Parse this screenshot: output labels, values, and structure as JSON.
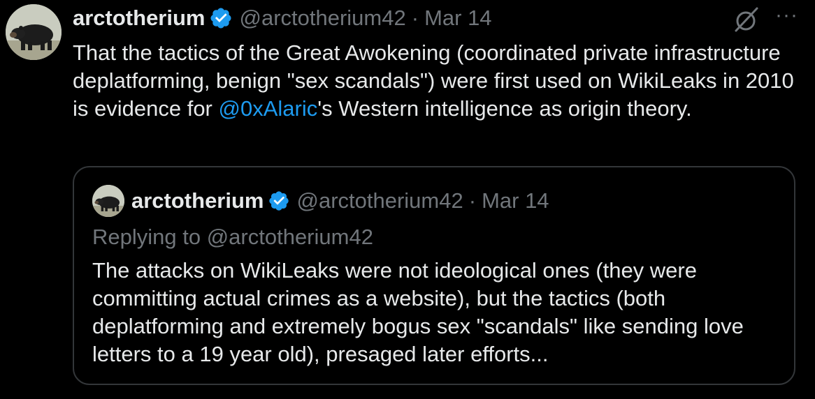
{
  "tweet": {
    "author_name": "arctotherium",
    "author_handle": "@arctotherium42",
    "separator": "·",
    "date": "Mar 14",
    "text_before_mention": "That the tactics of the Great Awokening (coordinated private infrastructure deplatforming, benign \"sex scandals\") were first used on WikiLeaks in 2010 is evidence for ",
    "mention": "@0xAlaric",
    "text_after_mention": "'s Western intelligence as origin theory.",
    "more_label": "···"
  },
  "quoted_tweet": {
    "author_name": "arctotherium",
    "author_handle": "@arctotherium42",
    "separator": "·",
    "date": "Mar 14",
    "reply_context": "Replying to @arctotherium42",
    "text": "The attacks on WikiLeaks were not ideological ones (they were committing actual crimes as a website), but the tactics (both deplatforming and extremely bogus sex \"scandals\" like sending love letters to a 19 year old), presaged later efforts..."
  },
  "colors": {
    "background": "#000000",
    "text": "#e7e9ea",
    "muted": "#71767b",
    "accent": "#1d9bf0",
    "border": "#333639"
  },
  "icons": {
    "verified": "verified-badge-icon",
    "hidden": "eye-slash-icon",
    "more": "more-horizontal-icon",
    "avatar": "bear-avatar"
  }
}
